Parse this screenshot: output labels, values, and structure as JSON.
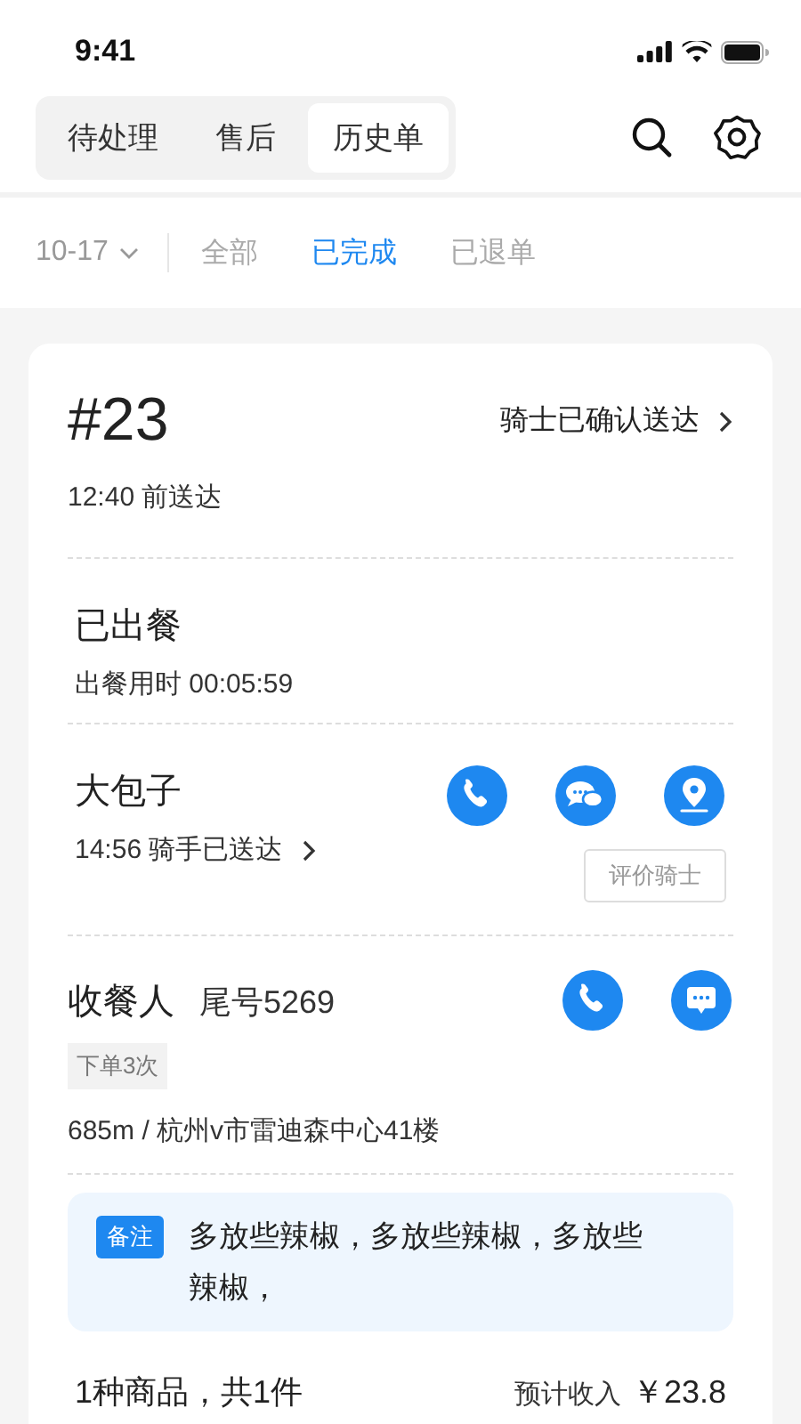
{
  "status_bar": {
    "time": "9:41"
  },
  "tabs": [
    {
      "label": "待处理",
      "selected": false
    },
    {
      "label": "售后",
      "selected": false
    },
    {
      "label": "历史单",
      "selected": true
    }
  ],
  "filters": {
    "date": "10-17",
    "items": [
      {
        "label": "全部",
        "selected": false
      },
      {
        "label": "已完成",
        "selected": true
      },
      {
        "label": "已退单",
        "selected": false
      }
    ]
  },
  "order": {
    "number": "#23",
    "delivery_status": "骑士已确认送达",
    "deadline": "12:40 前送达"
  },
  "meal": {
    "status": "已出餐",
    "duration": "出餐用时 00:05:59"
  },
  "rider": {
    "name": "大包子",
    "status": "14:56 骑手已送达",
    "actions": [
      {
        "kind": "phone"
      },
      {
        "kind": "chat"
      },
      {
        "kind": "location"
      }
    ],
    "rate_button": "评价骑士"
  },
  "customer": {
    "title": "收餐人",
    "phone_tail": "尾号5269",
    "actions": [
      {
        "kind": "phone"
      },
      {
        "kind": "message"
      }
    ],
    "tag": "下单3次",
    "address": "685m / 杭州v市雷迪森中心41楼"
  },
  "note": {
    "label": "备注",
    "text": "多放些辣椒，多放些辣椒，多放些辣椒，"
  },
  "summary": {
    "items": "1种商品，共1件",
    "income_label": "预计收入",
    "income": "￥23.8"
  }
}
